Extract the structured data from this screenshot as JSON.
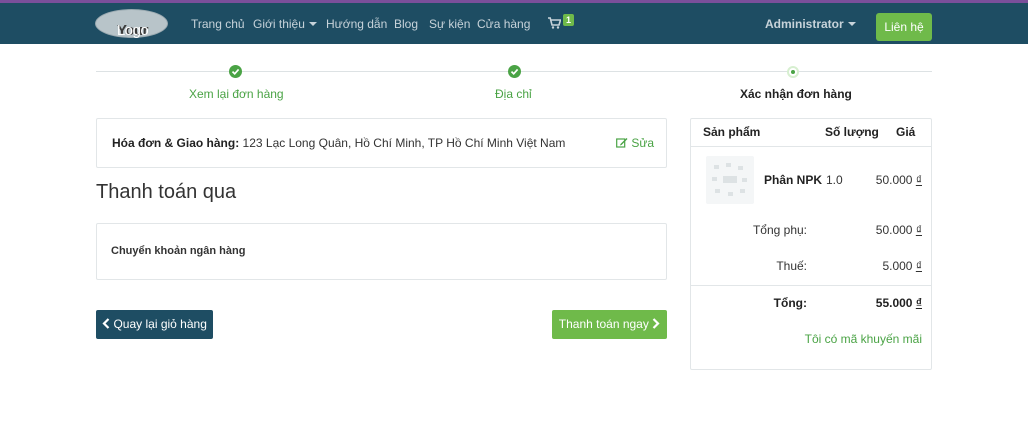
{
  "brand": {
    "logo_part1": "Your",
    "logo_part2": "Logo"
  },
  "nav": {
    "items": [
      {
        "label": "Trang chủ"
      },
      {
        "label": "Giới thiệu"
      },
      {
        "label": "Hướng dẫn"
      },
      {
        "label": "Blog"
      },
      {
        "label": "Sự kiện"
      },
      {
        "label": "Cửa hàng"
      }
    ],
    "cart_count": "1",
    "user": "Administrator",
    "contact_label": "Liên hệ"
  },
  "steps": [
    {
      "label": "Xem lại đơn hàng",
      "state": "done"
    },
    {
      "label": "Địa chỉ",
      "state": "done"
    },
    {
      "label": "Xác nhận đơn hàng",
      "state": "current"
    }
  ],
  "address": {
    "label": "Hóa đơn & Giao hàng:",
    "value": "123 Lạc Long Quân, Hồ Chí Minh, TP Hồ Chí Minh Việt Nam",
    "edit_label": "Sửa"
  },
  "payment": {
    "title": "Thanh toán qua",
    "method": "Chuyển khoản ngân hàng"
  },
  "actions": {
    "back_label": "Quay lại giỏ hàng",
    "pay_label": "Thanh toán ngay"
  },
  "summary": {
    "col_product": "Sản phẩm",
    "col_qty": "Số lượng",
    "col_price": "Giá",
    "product": {
      "name": "Phân NPK",
      "qty": "1.0",
      "price": "50.000",
      "currency": "₫"
    },
    "subtotal_label": "Tổng phụ:",
    "subtotal_value": "50.000",
    "tax_label": "Thuế:",
    "tax_value": "5.000",
    "total_label": "Tổng:",
    "total_value": "55.000",
    "currency": "₫",
    "promo_label": "Tôi có mã khuyến mãi"
  },
  "colors": {
    "navbar": "#1e4d63",
    "accent": "#6fba4a",
    "success": "#4aa345"
  }
}
